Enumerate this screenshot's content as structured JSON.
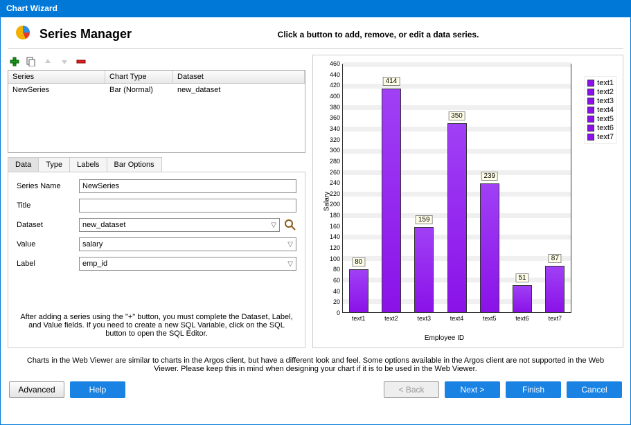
{
  "window": {
    "title": "Chart Wizard"
  },
  "header": {
    "title": "Series Manager",
    "subtitle": "Click a button to add, remove, or edit a data series."
  },
  "series_grid": {
    "columns": {
      "series": "Series",
      "chart_type": "Chart Type",
      "dataset": "Dataset"
    },
    "rows": [
      {
        "series": "NewSeries",
        "chart_type": "Bar (Normal)",
        "dataset": "new_dataset"
      }
    ]
  },
  "tabs": {
    "data": "Data",
    "type": "Type",
    "labels": "Labels",
    "bar_options": "Bar Options"
  },
  "form": {
    "series_name_label": "Series Name",
    "series_name_value": "NewSeries",
    "title_label": "Title",
    "title_value": "",
    "dataset_label": "Dataset",
    "dataset_value": "new_dataset",
    "value_label": "Value",
    "value_value": "salary",
    "label_label": "Label",
    "label_value": "emp_id",
    "help": "After adding a series using the \"+\" button, you must complete the Dataset, Label, and Value fields. If you need to create a new SQL Variable, click on the SQL button to open the SQL Editor."
  },
  "chart_data": {
    "type": "bar",
    "categories": [
      "text1",
      "text2",
      "text3",
      "text4",
      "text5",
      "text6",
      "text7"
    ],
    "values": [
      80,
      414,
      159,
      350,
      239,
      51,
      87
    ],
    "xlabel": "Employee ID",
    "ylabel": "Salary",
    "ylim": [
      0,
      460
    ],
    "yticks": [
      0,
      20,
      40,
      60,
      80,
      100,
      120,
      140,
      160,
      180,
      200,
      220,
      240,
      260,
      280,
      300,
      320,
      340,
      360,
      380,
      400,
      420,
      440,
      460
    ],
    "legend": [
      "text1",
      "text2",
      "text3",
      "text4",
      "text5",
      "text6",
      "text7"
    ]
  },
  "footer": {
    "note": "Charts in the Web Viewer are similar to charts in the Argos client, but have a different look and feel. Some options available in the Argos client are not supported in the Web Viewer. Please keep this in mind when designing your chart if it is to be used in the Web Viewer.",
    "advanced": "Advanced",
    "help": "Help",
    "back": "< Back",
    "next": "Next >",
    "finish": "Finish",
    "cancel": "Cancel"
  }
}
